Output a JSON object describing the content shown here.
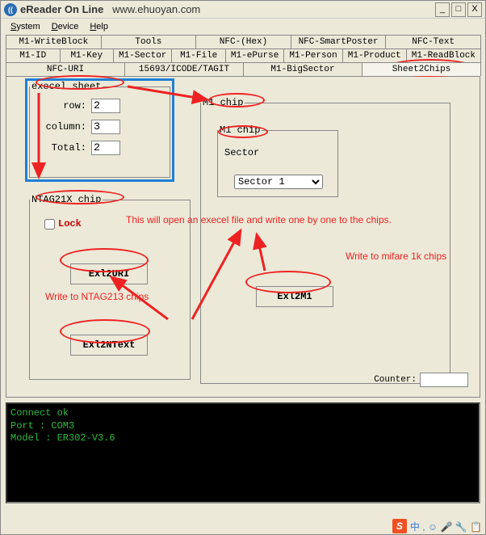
{
  "title_app": "eReader On Line",
  "title_url": "www.ehuoyan.com",
  "menu": {
    "system": "System",
    "device": "Device",
    "help": "Help"
  },
  "tabs_row1": [
    "M1-WriteBlock",
    "Tools",
    "NFC-(Hex)",
    "NFC-SmartPoster",
    "NFC-Text"
  ],
  "tabs_row2": [
    "M1-ID",
    "M1-Key",
    "M1-Sector",
    "M1-File",
    "M1-ePurse",
    "M1-Person",
    "M1-Product",
    "M1-ReadBlock"
  ],
  "tabs_row3": [
    "NFC-URI",
    "15693/ICODE/TAGIT",
    "M1-BigSector",
    "Sheet2Chips"
  ],
  "excel": {
    "legend": "execel sheet",
    "row_label": "row:",
    "row_val": "2",
    "col_label": "column:",
    "col_val": "3",
    "total_label": "Total:",
    "total_val": "2"
  },
  "m1": {
    "legend": "M1 chip",
    "inner_legend": "M1 chip",
    "sector_label": "Sector",
    "sector_sel": "Sector 1"
  },
  "ntag": {
    "legend": "NTAG21X chip",
    "lock": "Lock"
  },
  "buttons": {
    "exl2uri": "Exl2URI",
    "exl2ntext": "Exl2NText",
    "exl2m1": "Exl2M1"
  },
  "counter_label": "Counter:",
  "counter_val": "",
  "console": {
    "l1": "Connect ok",
    "l2": "Port : COM3",
    "l3": "Model : ER302-V3.6"
  },
  "annot": {
    "open_excel": "This will open an execel file and write one by one to the chips.",
    "write_mifare": "Write to mifare 1k chips",
    "write_ntag": "Write to NTAG213 chips"
  },
  "tray_text": "中 , ☺ 🎤 🔧 📋"
}
